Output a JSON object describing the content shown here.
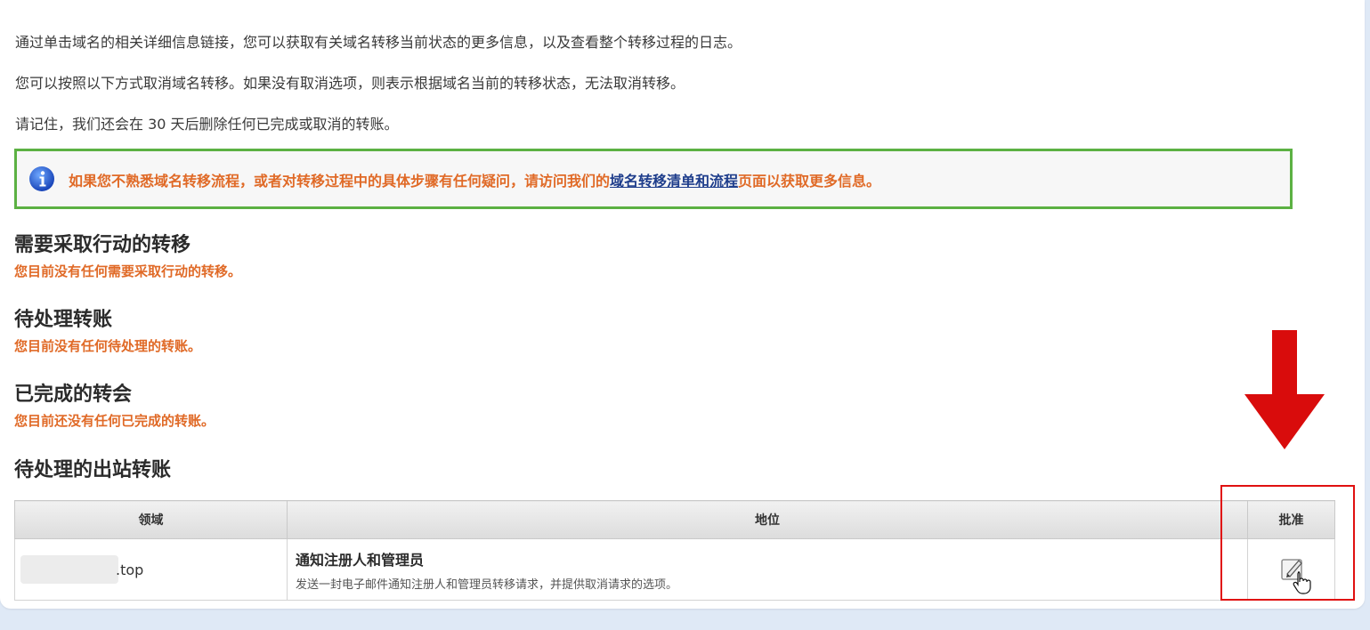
{
  "intro": {
    "line1": "通过单击域名的相关详细信息链接，您可以获取有关域名转移当前状态的更多信息，以及查看整个转移过程的日志。",
    "line2": "您可以按照以下方式取消域名转移。如果没有取消选项，则表示根据域名当前的转移状态，无法取消转移。",
    "line3": "请记住，我们还会在 30 天后删除任何已完成或取消的转账。"
  },
  "notice": {
    "icon": "info-icon",
    "text_before": "如果您不熟悉域名转移流程，或者对转移过程中的具体步骤有任何疑问，请访问我们的",
    "link_text": "域名转移清单和流程",
    "text_after": "页面以获取更多信息。"
  },
  "sections": {
    "action_required": {
      "title": "需要采取行动的转移",
      "message": "您目前没有任何需要采取行动的转移。"
    },
    "pending": {
      "title": "待处理转账",
      "message": "您目前没有任何待处理的转账。"
    },
    "completed": {
      "title": "已完成的转会",
      "message": "您目前还没有任何已完成的转账。"
    },
    "outbound": {
      "title": "待处理的出站转账"
    }
  },
  "table": {
    "headers": {
      "domain": "领域",
      "status": "地位",
      "approve": "批准"
    },
    "rows": [
      {
        "domain_suffix": ".top",
        "status_title": "通知注册人和管理员",
        "status_desc": "发送一封电子邮件通知注册人和管理员转移请求，并提供取消请求的选项。"
      }
    ]
  },
  "colors": {
    "accent_orange": "#e06a27",
    "notice_border": "#5cb143",
    "link": "#1f3e8c",
    "highlight_red": "#e01010"
  }
}
